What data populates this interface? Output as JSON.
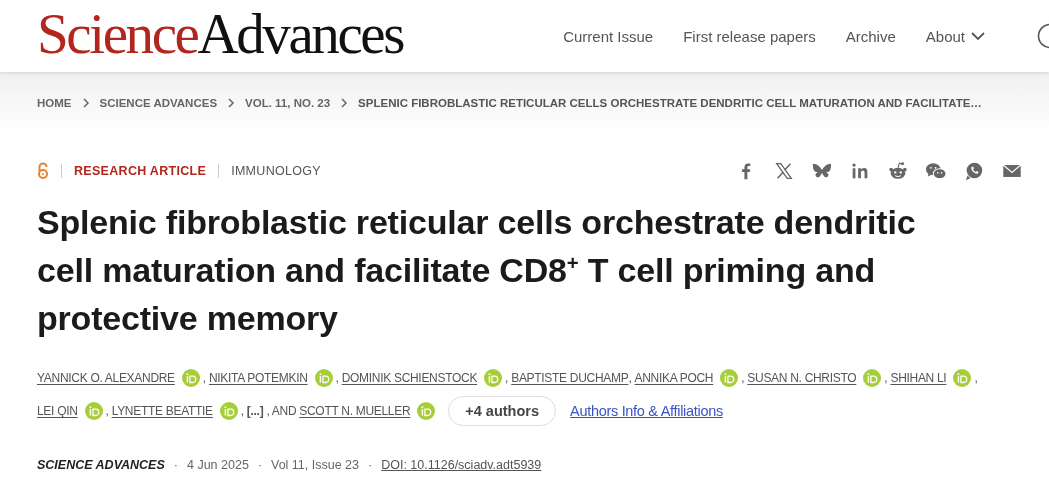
{
  "header": {
    "logo": {
      "part_1": "Science",
      "part_2": "Advances"
    },
    "nav": [
      {
        "label": "Current Issue",
        "dropdown": false
      },
      {
        "label": "First release papers",
        "dropdown": false
      },
      {
        "label": "Archive",
        "dropdown": false
      },
      {
        "label": "About",
        "dropdown": true
      }
    ]
  },
  "breadcrumb": [
    "HOME",
    "SCIENCE ADVANCES",
    "VOL. 11, NO. 23",
    "SPLENIC FIBROBLASTIC RETICULAR CELLS ORCHESTRATE DENDRITIC CELL MATURATION AND FACILITATE…"
  ],
  "article": {
    "open_access": true,
    "type": "RESEARCH ARTICLE",
    "subject": "IMMUNOLOGY",
    "share": [
      {
        "kind": "facebook"
      },
      {
        "kind": "x"
      },
      {
        "kind": "butterfly"
      },
      {
        "kind": "linkedin"
      },
      {
        "kind": "reddit"
      },
      {
        "kind": "wechat"
      },
      {
        "kind": "whatsapp"
      },
      {
        "kind": "mail"
      }
    ],
    "title": "Splenic fibroblastic reticular cells orchestrate dendritic cell maturation and facilitate CD8$^{+}$ T cell priming and protective memory",
    "authors": [
      {
        "name": "YANNICK O. ALEXANDRE",
        "orcid": true
      },
      {
        "name": "NIKITA POTEMKIN",
        "orcid": true
      },
      {
        "name": "DOMINIK SCHIENSTOCK",
        "orcid": true
      },
      {
        "name": "BAPTISTE DUCHAMP",
        "orcid": false
      },
      {
        "name": "ANNIKA POCH",
        "orcid": true
      },
      {
        "name": "SUSAN N. CHRISTO",
        "orcid": true
      },
      {
        "name": "SHIHAN LI",
        "orcid": true
      },
      {
        "name": "LEI QIN",
        "orcid": true
      },
      {
        "name": "LYNETTE BEATTIE",
        "orcid": true
      }
    ],
    "ellipsis": "[...]",
    "and": ", AND",
    "last_author": {
      "name": "SCOTT N. MUELLER",
      "orcid": true
    },
    "more_authors": "+4 authors",
    "affiliations_link": "Authors Info & Affiliations",
    "comma": ",",
    "dot": "·",
    "journal": "SCIENCE ADVANCES",
    "date": "4 Jun 2025",
    "issue": "Vol 11, Issue 23",
    "doi": "DOI: 10.1126/sciadv.adt5939"
  }
}
